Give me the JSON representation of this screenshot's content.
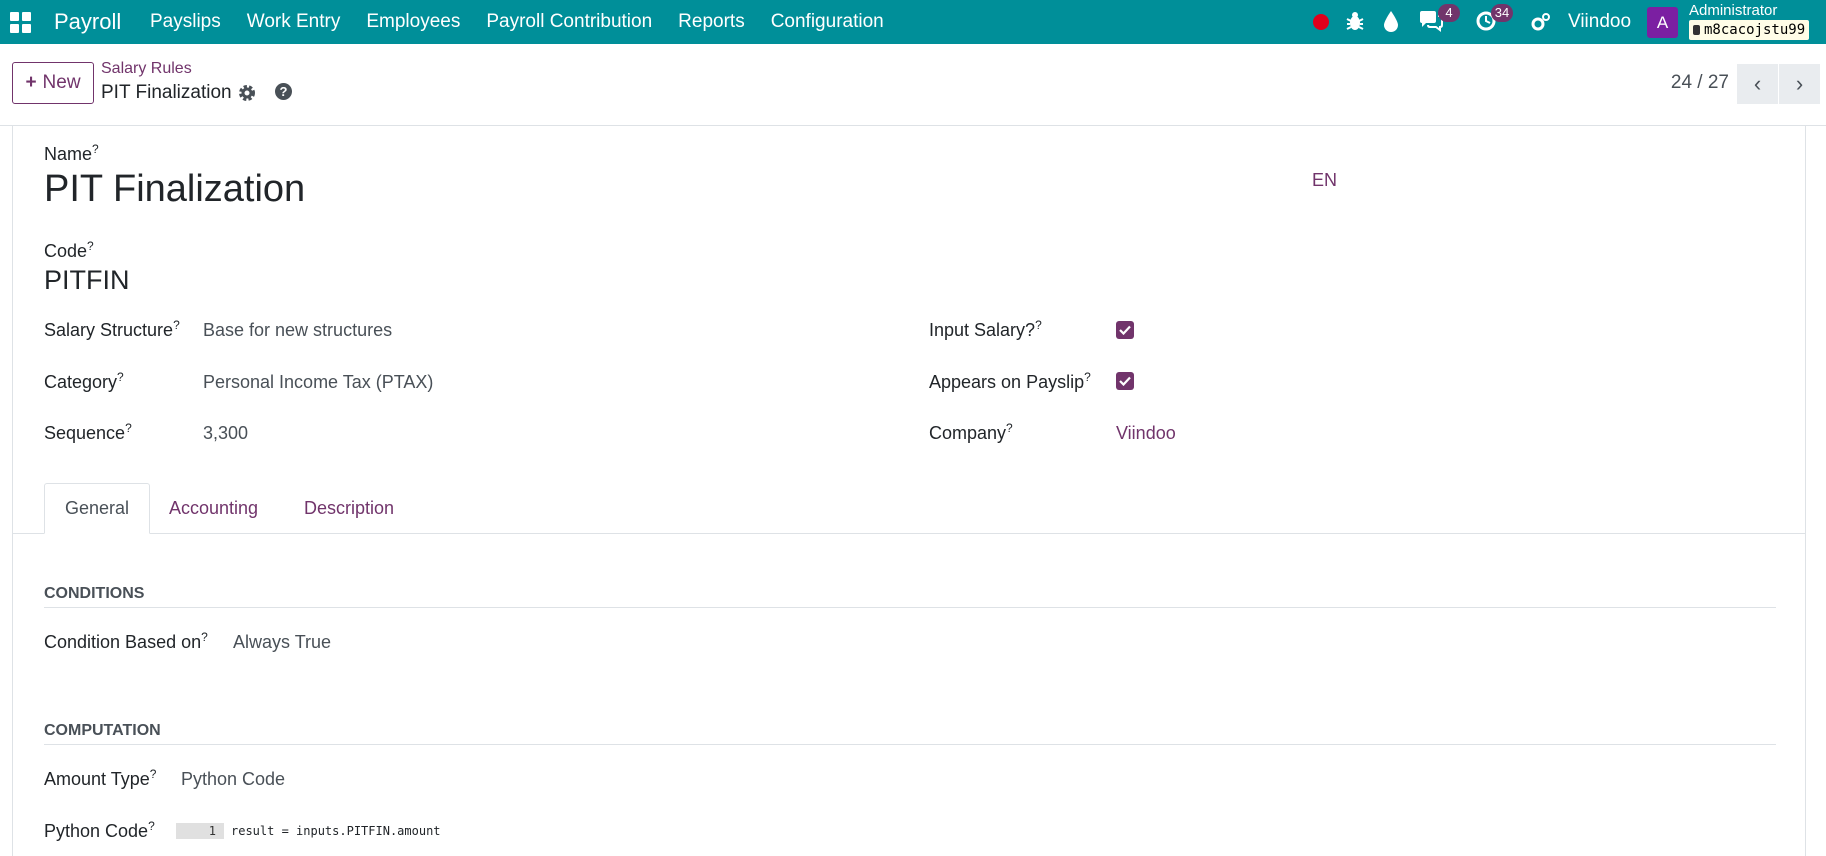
{
  "topbar": {
    "app_name": "Payroll",
    "menu": [
      "Payslips",
      "Work Entry",
      "Employees",
      "Payroll Contribution",
      "Reports",
      "Configuration"
    ],
    "chat_count": "4",
    "activity_count": "34",
    "company": "Viindoo",
    "avatar_letter": "A",
    "user_name": "Administrator",
    "database": "m8cacojstu99",
    "colors": {
      "bar": "#008f99",
      "accent": "#71346b",
      "record": "#e0001b",
      "avatar": "#7b1fa2"
    }
  },
  "control": {
    "new_label": "New",
    "breadcrumb_parent": "Salary Rules",
    "breadcrumb_current": "PIT Finalization",
    "pager": "24 / 27"
  },
  "form": {
    "name_label": "Name",
    "name_value": "PIT Finalization",
    "lang": "EN",
    "code_label": "Code",
    "code_value": "PITFIN",
    "left_fields": [
      {
        "label": "Salary Structure",
        "value": "Base for new structures"
      },
      {
        "label": "Category",
        "value": "Personal Income Tax (PTAX)"
      },
      {
        "label": "Sequence",
        "value": "3,300"
      }
    ],
    "right_fields": {
      "input_salary_label": "Input Salary?",
      "input_salary_checked": true,
      "appears_label": "Appears on Payslip",
      "appears_checked": true,
      "company_label": "Company",
      "company_value": "Viindoo"
    },
    "help_mark": "?"
  },
  "tabs": [
    "General",
    "Accounting",
    "Description"
  ],
  "general": {
    "conditions_title": "CONDITIONS",
    "condition_label": "Condition Based on",
    "condition_value": "Always True",
    "computation_title": "COMPUTATION",
    "amount_type_label": "Amount Type",
    "amount_type_value": "Python Code",
    "python_code_label": "Python Code",
    "line_number": "1",
    "code_line": "result = inputs.PITFIN.amount"
  }
}
